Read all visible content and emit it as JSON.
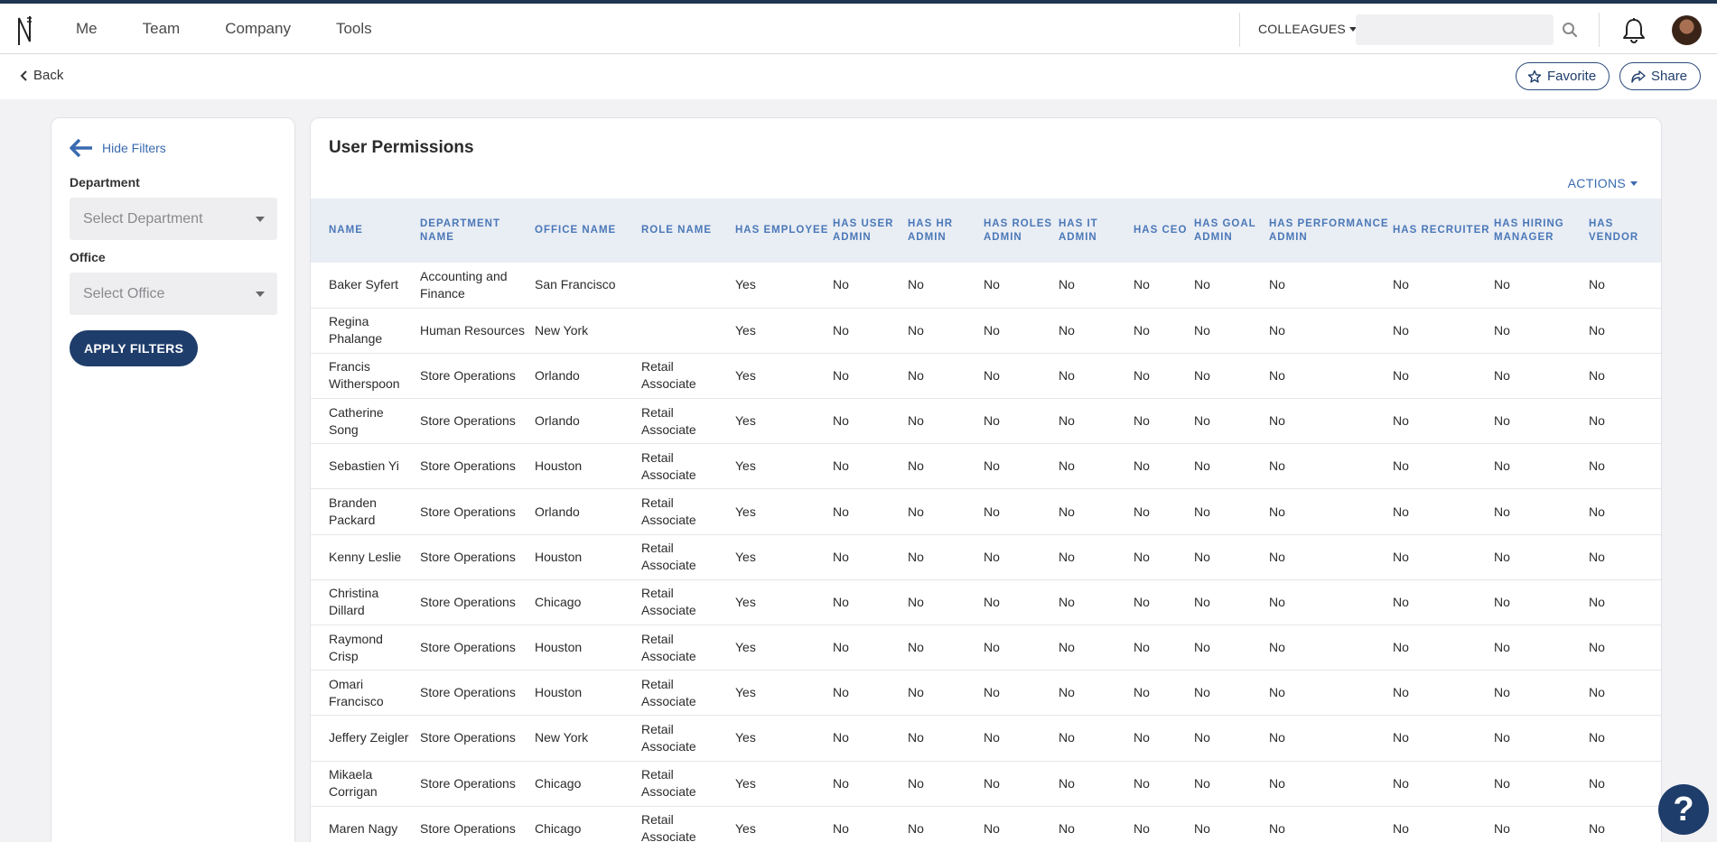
{
  "nav": {
    "items": [
      "Me",
      "Team",
      "Company",
      "Tools"
    ]
  },
  "header": {
    "colleagues_label": "COLLEAGUES",
    "search_placeholder": ""
  },
  "subbar": {
    "back_label": "Back",
    "favorite_label": "Favorite",
    "share_label": "Share"
  },
  "filters": {
    "hide_label": "Hide Filters",
    "department_label": "Department",
    "department_placeholder": "Select Department",
    "office_label": "Office",
    "office_placeholder": "Select Office",
    "apply_label": "APPLY FILTERS"
  },
  "main": {
    "title": "User Permissions",
    "actions_label": "ACTIONS",
    "columns": [
      "Name",
      "Department Name",
      "Office Name",
      "Role Name",
      "Has Employee",
      "Has User Admin",
      "Has HR Admin",
      "Has Roles Admin",
      "Has IT Admin",
      "Has CEO",
      "Has Goal Admin",
      "Has Performance Admin",
      "Has Recruiter",
      "Has Hiring Manager",
      "Has Vendor"
    ],
    "rows": [
      [
        "Baker Syfert",
        "Accounting and Finance",
        "San Francisco",
        "",
        "Yes",
        "No",
        "No",
        "No",
        "No",
        "No",
        "No",
        "No",
        "No",
        "No",
        "No"
      ],
      [
        "Regina Phalange",
        "Human Resources",
        "New York",
        "",
        "Yes",
        "No",
        "No",
        "No",
        "No",
        "No",
        "No",
        "No",
        "No",
        "No",
        "No"
      ],
      [
        "Francis Witherspoon",
        "Store Operations",
        "Orlando",
        "Retail Associate",
        "Yes",
        "No",
        "No",
        "No",
        "No",
        "No",
        "No",
        "No",
        "No",
        "No",
        "No"
      ],
      [
        "Catherine Song",
        "Store Operations",
        "Orlando",
        "Retail Associate",
        "Yes",
        "No",
        "No",
        "No",
        "No",
        "No",
        "No",
        "No",
        "No",
        "No",
        "No"
      ],
      [
        "Sebastien Yi",
        "Store Operations",
        "Houston",
        "Retail Associate",
        "Yes",
        "No",
        "No",
        "No",
        "No",
        "No",
        "No",
        "No",
        "No",
        "No",
        "No"
      ],
      [
        "Branden Packard",
        "Store Operations",
        "Orlando",
        "Retail Associate",
        "Yes",
        "No",
        "No",
        "No",
        "No",
        "No",
        "No",
        "No",
        "No",
        "No",
        "No"
      ],
      [
        "Kenny Leslie",
        "Store Operations",
        "Houston",
        "Retail Associate",
        "Yes",
        "No",
        "No",
        "No",
        "No",
        "No",
        "No",
        "No",
        "No",
        "No",
        "No"
      ],
      [
        "Christina Dillard",
        "Store Operations",
        "Chicago",
        "Retail Associate",
        "Yes",
        "No",
        "No",
        "No",
        "No",
        "No",
        "No",
        "No",
        "No",
        "No",
        "No"
      ],
      [
        "Raymond Crisp",
        "Store Operations",
        "Houston",
        "Retail Associate",
        "Yes",
        "No",
        "No",
        "No",
        "No",
        "No",
        "No",
        "No",
        "No",
        "No",
        "No"
      ],
      [
        "Omari Francisco",
        "Store Operations",
        "Houston",
        "Retail Associate",
        "Yes",
        "No",
        "No",
        "No",
        "No",
        "No",
        "No",
        "No",
        "No",
        "No",
        "No"
      ],
      [
        "Jeffery Zeigler",
        "Store Operations",
        "New York",
        "Retail Associate",
        "Yes",
        "No",
        "No",
        "No",
        "No",
        "No",
        "No",
        "No",
        "No",
        "No",
        "No"
      ],
      [
        "Mikaela Corrigan",
        "Store Operations",
        "Chicago",
        "Retail Associate",
        "Yes",
        "No",
        "No",
        "No",
        "No",
        "No",
        "No",
        "No",
        "No",
        "No",
        "No"
      ],
      [
        "Maren Nagy",
        "Store Operations",
        "Chicago",
        "Retail Associate",
        "Yes",
        "No",
        "No",
        "No",
        "No",
        "No",
        "No",
        "No",
        "No",
        "No",
        "No"
      ]
    ]
  },
  "help": {
    "label": "?"
  },
  "colors": {
    "primary": "#1f3d6b",
    "link": "#3a6bb0",
    "header_bg": "#e9edf4",
    "page_bg": "#f2f2f4"
  }
}
